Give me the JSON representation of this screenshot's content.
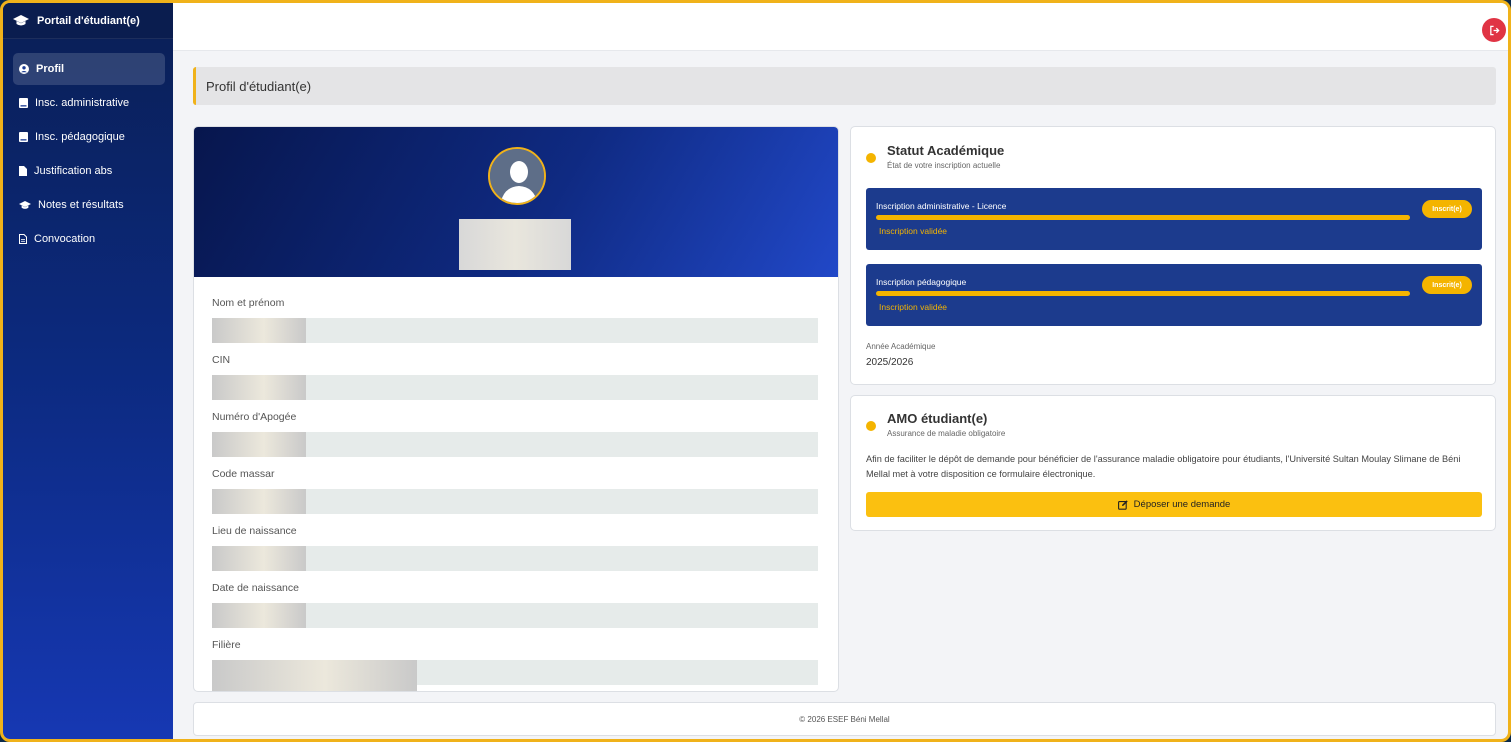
{
  "app": {
    "brand_title": "Portail d'étudiant(e)"
  },
  "sidebar": {
    "items": [
      {
        "label": "Profil",
        "icon": "user-circle-icon",
        "active": true
      },
      {
        "label": "Insc. administrative",
        "icon": "book-icon"
      },
      {
        "label": "Insc. pédagogique",
        "icon": "book-icon"
      },
      {
        "label": "Justification abs",
        "icon": "file-icon"
      },
      {
        "label": "Notes et résultats",
        "icon": "graduation-cap-icon"
      },
      {
        "label": "Convocation",
        "icon": "document-icon"
      }
    ]
  },
  "page": {
    "title": "Profil d'étudiant(e)"
  },
  "profile": {
    "fields": [
      {
        "label": "Nom et prénom"
      },
      {
        "label": "CIN"
      },
      {
        "label": "Numéro d'Apogée"
      },
      {
        "label": "Code massar"
      },
      {
        "label": "Lieu de naissance"
      },
      {
        "label": "Date de naissance"
      },
      {
        "label": "Filière"
      }
    ]
  },
  "status": {
    "title": "Statut Académique",
    "subtitle": "État de votre inscription actuelle",
    "inscriptions": [
      {
        "title": "Inscription administrative - Licence",
        "status": "Inscription validée",
        "badge": "Inscrit(e)",
        "progress": 1.0
      },
      {
        "title": "Inscription pédagogique",
        "status": "Inscription validée",
        "badge": "Inscrit(e)",
        "progress": 1.0
      }
    ],
    "year_label": "Année Académique",
    "year_value": "2025/2026"
  },
  "amo": {
    "title": "AMO étudiant(e)",
    "subtitle": "Assurance de maladie obligatoire",
    "description": "Afin de faciliter le dépôt de demande pour bénéficier de l'assurance maladie obligatoire pour étudiants, l'Université Sultan Moulay Slimane de Béni Mellal met à votre disposition ce formulaire électronique.",
    "button_label": "Déposer une demande"
  },
  "footer": {
    "text": "© 2026 ESEF Béni Mellal"
  },
  "colors": {
    "accent": "#f4b400",
    "sidebar": "#0c2a80",
    "logout": "#e03444",
    "inscription_box": "#1c3b8d"
  }
}
